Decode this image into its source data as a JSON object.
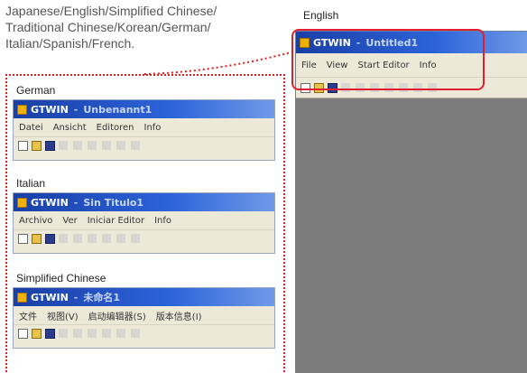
{
  "description": {
    "line1": "Japanese/English/Simplified Chinese/",
    "line2": "Traditional Chinese/Korean/German/",
    "line3": "Italian/Spanish/French."
  },
  "colors": {
    "callout_red": "#e02020",
    "titlebar_blue": "#2c63d9",
    "menu_bg": "#ece9d8",
    "canvas_gray": "#808080"
  },
  "english": {
    "label": "English",
    "app_name": "GTWIN",
    "separator": "-",
    "doc_title": "Untitled1",
    "menu": [
      "File",
      "View",
      "Start Editor",
      "Info"
    ]
  },
  "german": {
    "label": "German",
    "app_name": "GTWIN",
    "separator": "-",
    "doc_title": "Unbenannt1",
    "menu": [
      "Datei",
      "Ansicht",
      "Editoren",
      "Info"
    ]
  },
  "italian": {
    "label": "Italian",
    "app_name": "GTWIN",
    "separator": "-",
    "doc_title": "Sin Titulo1",
    "menu": [
      "Archivo",
      "Ver",
      "Iniciar Editor",
      "Info"
    ]
  },
  "chinese": {
    "label": "Simplified Chinese",
    "app_name": "GTWIN",
    "separator": "-",
    "doc_title": "未命名1",
    "menu": [
      "文件",
      "视图(V)",
      "启动编辑器(S)",
      "版本信息(I)"
    ]
  },
  "icons": {
    "app": "gtwin-app-icon",
    "new": "new-file-icon",
    "open": "open-folder-icon",
    "save": "save-disk-icon"
  }
}
